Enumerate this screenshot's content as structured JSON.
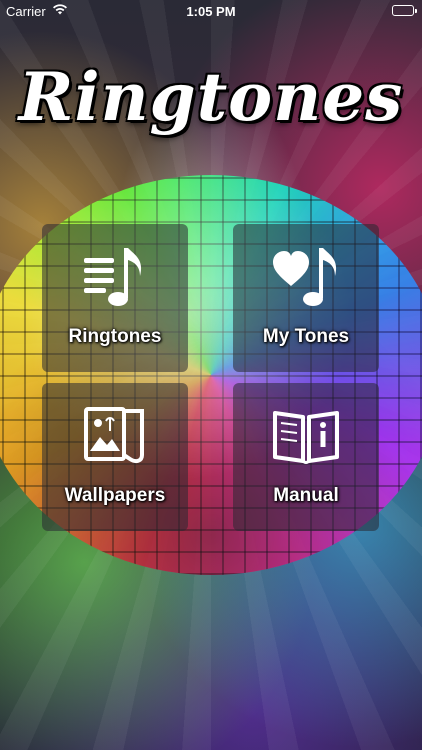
{
  "status_bar": {
    "carrier": "Carrier",
    "time": "1:05 PM"
  },
  "app_title": "Ringtones",
  "menu": [
    {
      "label": "Ringtones",
      "icon": "music-list-icon"
    },
    {
      "label": "My Tones",
      "icon": "heart-note-icon"
    },
    {
      "label": "Wallpapers",
      "icon": "wallpaper-icon"
    },
    {
      "label": "Manual",
      "icon": "manual-book-icon"
    }
  ]
}
